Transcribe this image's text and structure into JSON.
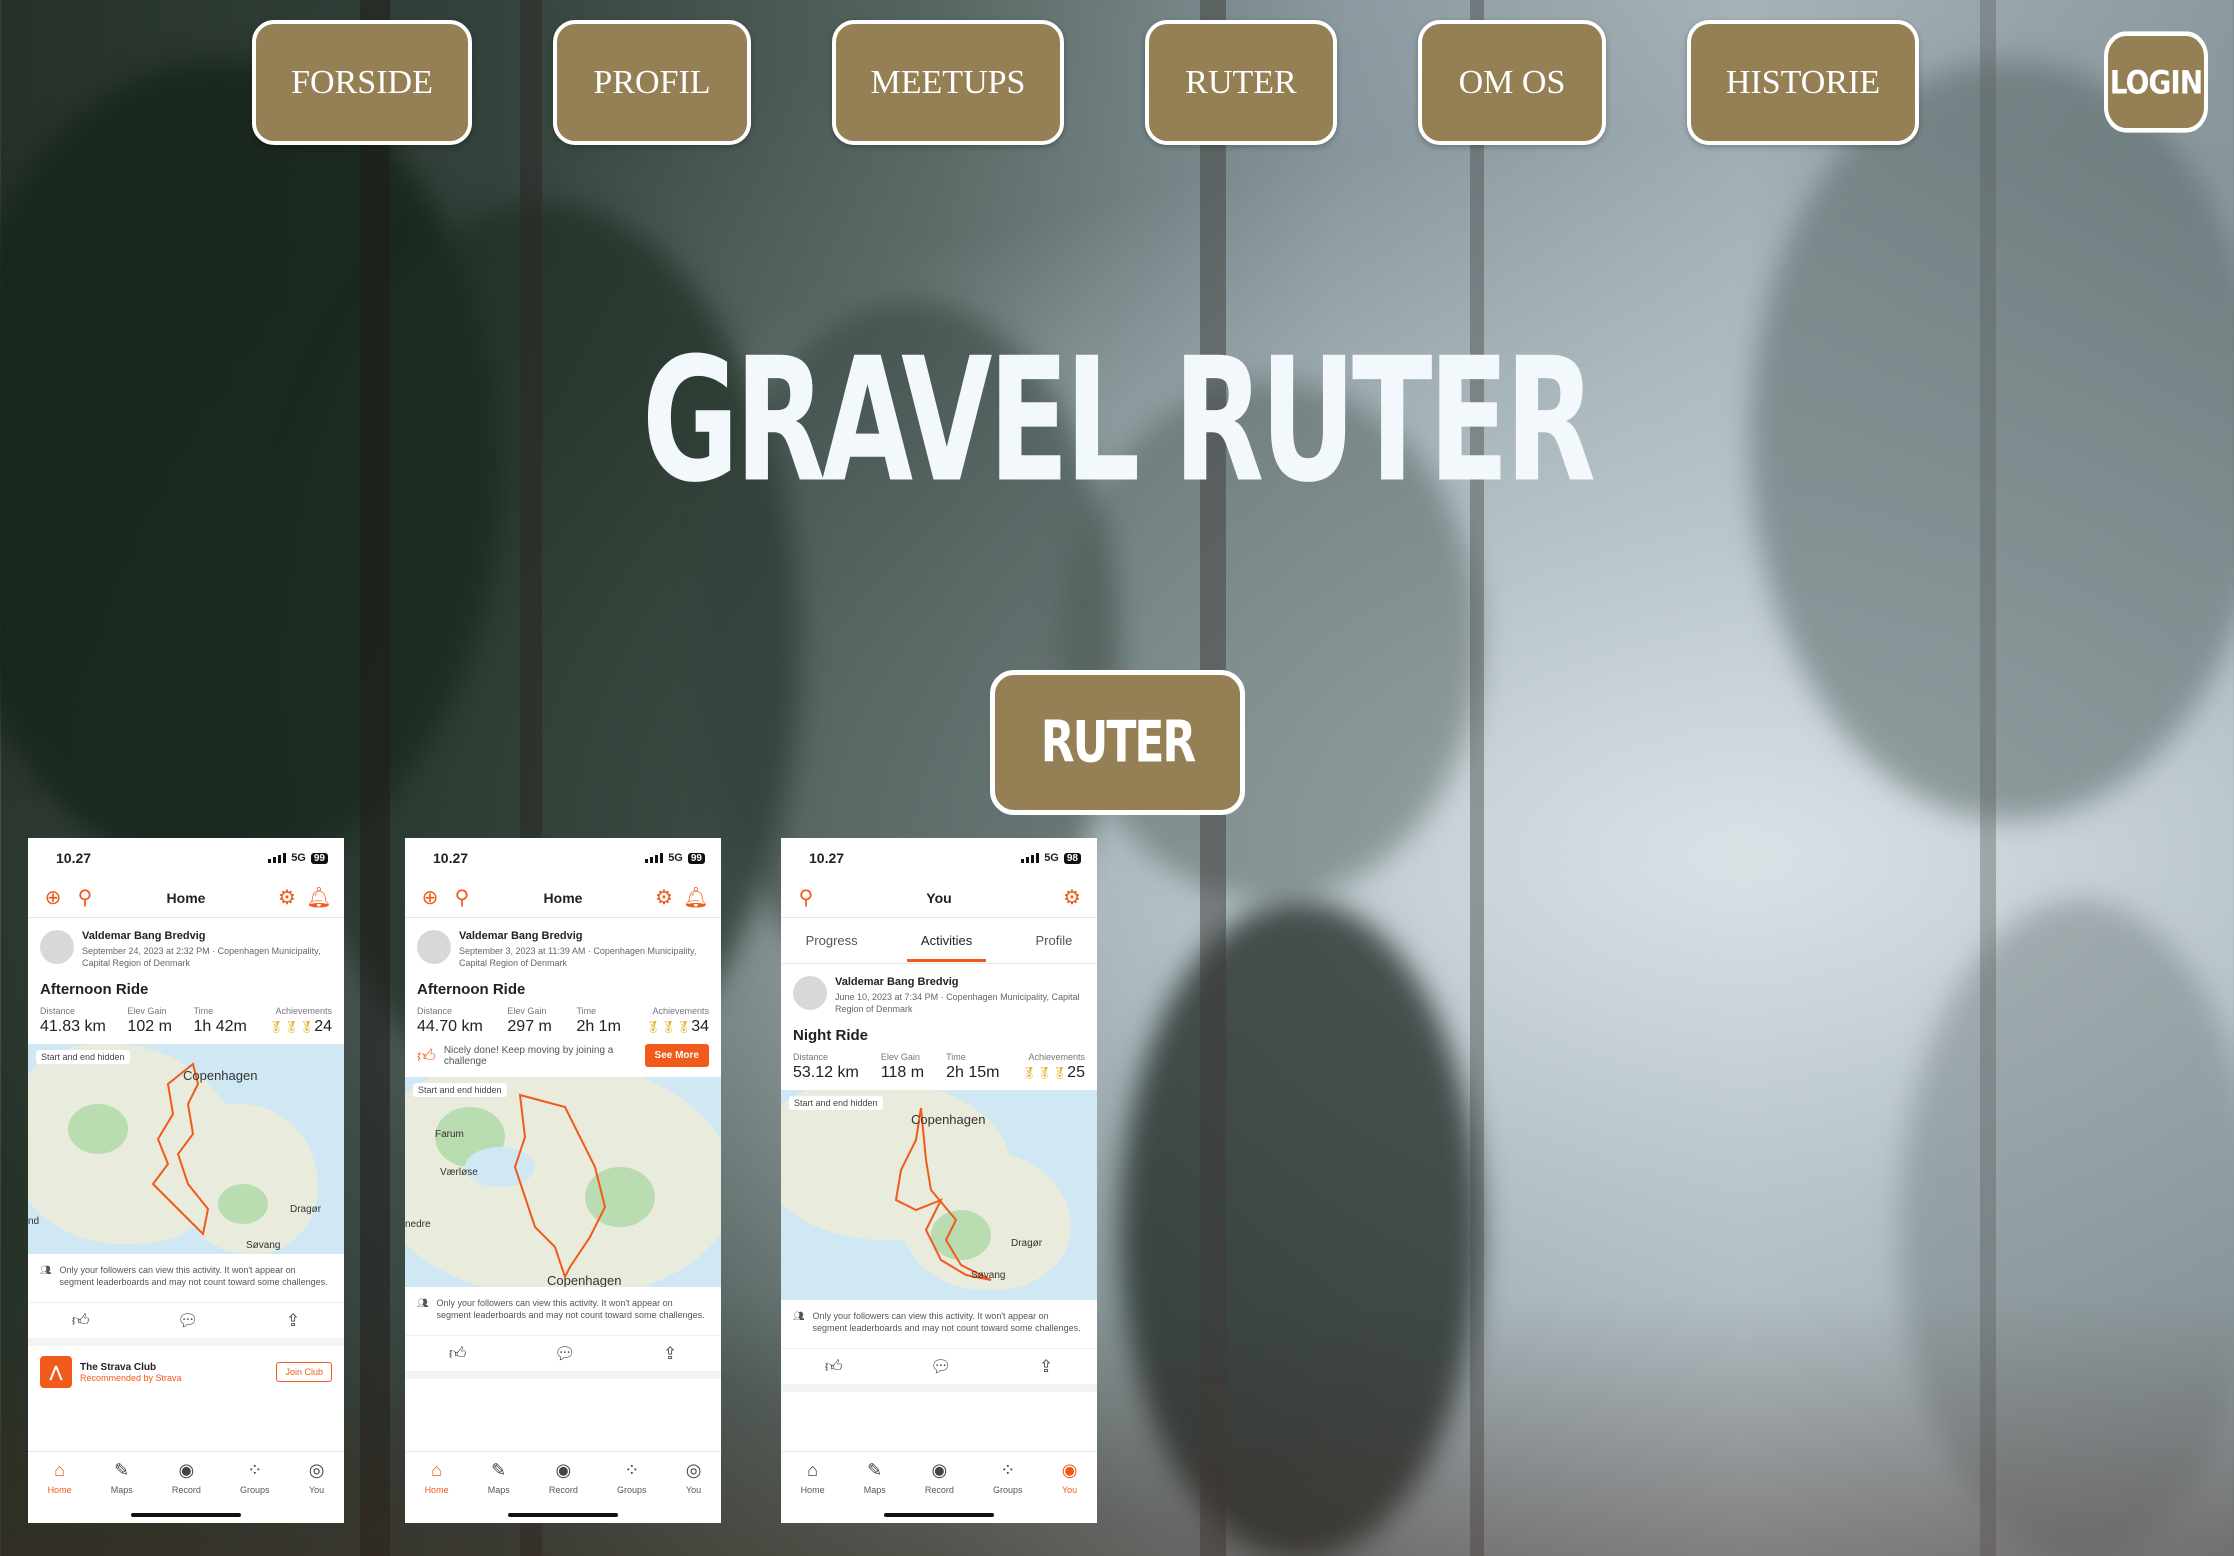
{
  "nav": {
    "items": [
      "FORSIDE",
      "PROFIL",
      "MEETUPS",
      "RUTER",
      "OM OS",
      "HISTORIE"
    ],
    "login": "LOGIN"
  },
  "hero": {
    "title": "GRAVEL RUTER",
    "button": "RUTER"
  },
  "colors": {
    "button_bg": "#957f55",
    "button_border": "#ffffff",
    "strava_orange": "#f05a1a"
  },
  "phones": [
    {
      "time": "10.27",
      "network": "5G",
      "battery": "99",
      "header": "Home",
      "athlete": "Valdemar Bang Bredvig",
      "meta": "September 24, 2023 at 2:32 PM · Copenhagen Municipality, Capital Region of Denmark",
      "ride": "Afternoon Ride",
      "stats": {
        "distance_label": "Distance",
        "distance": "41.83 km",
        "elev_label": "Elev Gain",
        "elev": "102 m",
        "time_label": "Time",
        "time": "1h 42m",
        "ach_label": "Achievements",
        "ach": "24"
      },
      "map": {
        "tag": "Start and end hidden",
        "labels": [
          "Copenhagen",
          "Dragør",
          "Søvang",
          "nd"
        ]
      },
      "note": "Only your followers can view this activity. It won't appear on segment leaderboards and may not count toward some challenges.",
      "club": {
        "name": "The Strava Club",
        "sub": "Recommended by Strava",
        "join": "Join Club"
      },
      "tabs": [
        "Home",
        "Maps",
        "Record",
        "Groups",
        "You"
      ]
    },
    {
      "time": "10.27",
      "network": "5G",
      "battery": "99",
      "header": "Home",
      "athlete": "Valdemar Bang Bredvig",
      "meta": "September 3, 2023 at 11:39 AM · Copenhagen Municipality, Capital Region of Denmark",
      "ride": "Afternoon Ride",
      "stats": {
        "distance_label": "Distance",
        "distance": "44.70 km",
        "elev_label": "Elev Gain",
        "elev": "297 m",
        "time_label": "Time",
        "time": "2h 1m",
        "ach_label": "Achievements",
        "ach": "34"
      },
      "challenge": {
        "text": "Nicely done! Keep moving by joining a challenge",
        "button": "See More"
      },
      "map": {
        "tag": "Start and end hidden",
        "labels": [
          "Farum",
          "Værløse",
          "nedre",
          "Copenhagen"
        ]
      },
      "note": "Only your followers can view this activity. It won't appear on segment leaderboards and may not count toward some challenges.",
      "tabs": [
        "Home",
        "Maps",
        "Record",
        "Groups",
        "You"
      ]
    },
    {
      "time": "10.27",
      "network": "5G",
      "battery": "98",
      "header": "You",
      "subtabs": [
        "Progress",
        "Activities",
        "Profile"
      ],
      "athlete": "Valdemar Bang Bredvig",
      "meta": "June 10, 2023 at 7:34 PM · Copenhagen Municipality, Capital Region of Denmark",
      "ride": "Night Ride",
      "stats": {
        "distance_label": "Distance",
        "distance": "53.12 km",
        "elev_label": "Elev Gain",
        "elev": "118 m",
        "time_label": "Time",
        "time": "2h 15m",
        "ach_label": "Achievements",
        "ach": "25"
      },
      "map": {
        "tag": "Start and end hidden",
        "labels": [
          "Copenhagen",
          "Dragør",
          "Søvang"
        ]
      },
      "note": "Only your followers can view this activity. It won't appear on segment leaderboards and may not count toward some challenges.",
      "tabs": [
        "Home",
        "Maps",
        "Record",
        "Groups",
        "You"
      ]
    }
  ]
}
